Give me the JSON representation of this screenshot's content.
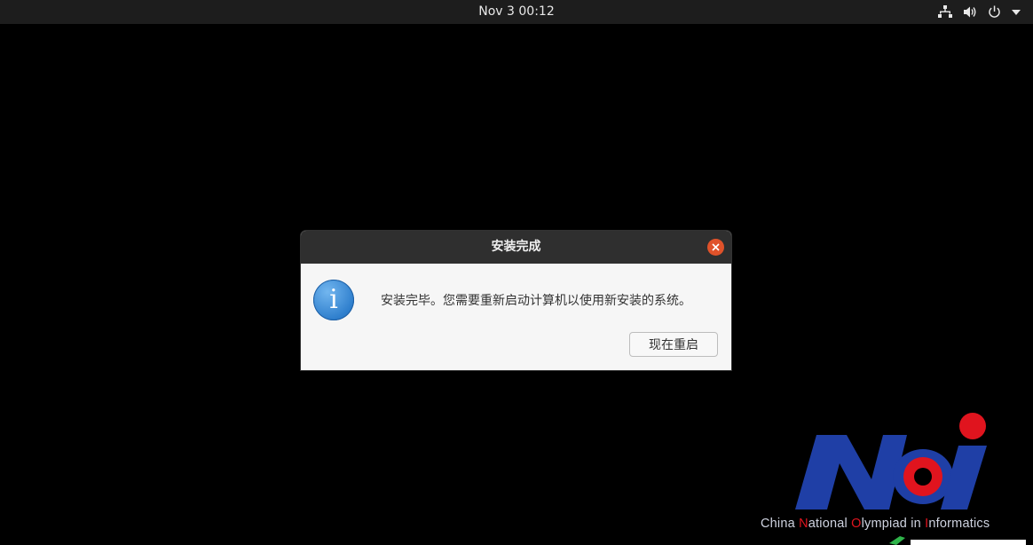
{
  "topbar": {
    "clock": "Nov 3  00:12",
    "icons": [
      "network-icon",
      "volume-icon",
      "power-icon",
      "chevron-down-icon"
    ]
  },
  "dialog": {
    "title": "安装完成",
    "message": "安装完毕。您需要重新启动计算机以使用新安装的系统。",
    "restart_label": "现在重启",
    "icon": "info-icon",
    "close_icon": "close-icon"
  },
  "logo": {
    "text": "NOI",
    "caption": {
      "part1": "China ",
      "n": "N",
      "part2": "ational ",
      "o": "O",
      "part3": "lympiad in ",
      "i": "I",
      "part4": "nformatics"
    }
  },
  "colors": {
    "close_button": "#e0522a",
    "noi_blue": "#1f3fa6",
    "noi_red": "#e0141e",
    "topbar": "#1d1d1d",
    "titlebar": "#2f2f2f"
  }
}
